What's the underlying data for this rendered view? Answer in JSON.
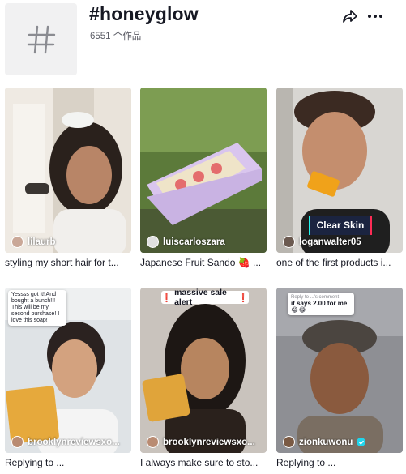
{
  "header": {
    "title": "#honeyglow",
    "count": "6551 个作品",
    "icons": {
      "hashtag": "hashtag-icon",
      "share": "share-icon",
      "more": "more-icon"
    }
  },
  "colors": {
    "verified": "#20d5ec",
    "text": "#161823",
    "muted": "#5c5d66",
    "placeholder_bg": "#f1f1f2",
    "badge_bg": "#1b2440",
    "cyan_shadow": "#25f4ee",
    "red_shadow": "#fe2c55"
  },
  "videos": [
    {
      "author": "lilaurb",
      "caption": "styling my short hair for t...",
      "verified": false
    },
    {
      "author": "luiscarloszara",
      "caption": "Japanese Fruit Sando 🍓 ...",
      "verified": false
    },
    {
      "author": "loganwalter05",
      "caption": "one of the first products i...",
      "verified": false,
      "overlay": "Clear Skin"
    },
    {
      "author": "brooklynreviewsxo...",
      "caption": "Replying to ...",
      "verified": false,
      "sticker": "Yessss got it! And bought a bunch!!! This will be my second purchase! I love this soap!"
    },
    {
      "author": "brooklynreviewsxo...",
      "caption": "I always make sure to sto...",
      "verified": false,
      "overlay": "massive sale alert",
      "overlay_mark": "❗"
    },
    {
      "author": "zionkuwonu",
      "caption": "Replying to ...",
      "verified": true,
      "sticker_top": "Reply to ...'s comment",
      "sticker": "it says 2.00 for me",
      "sticker_emoji": "😂😂"
    }
  ]
}
